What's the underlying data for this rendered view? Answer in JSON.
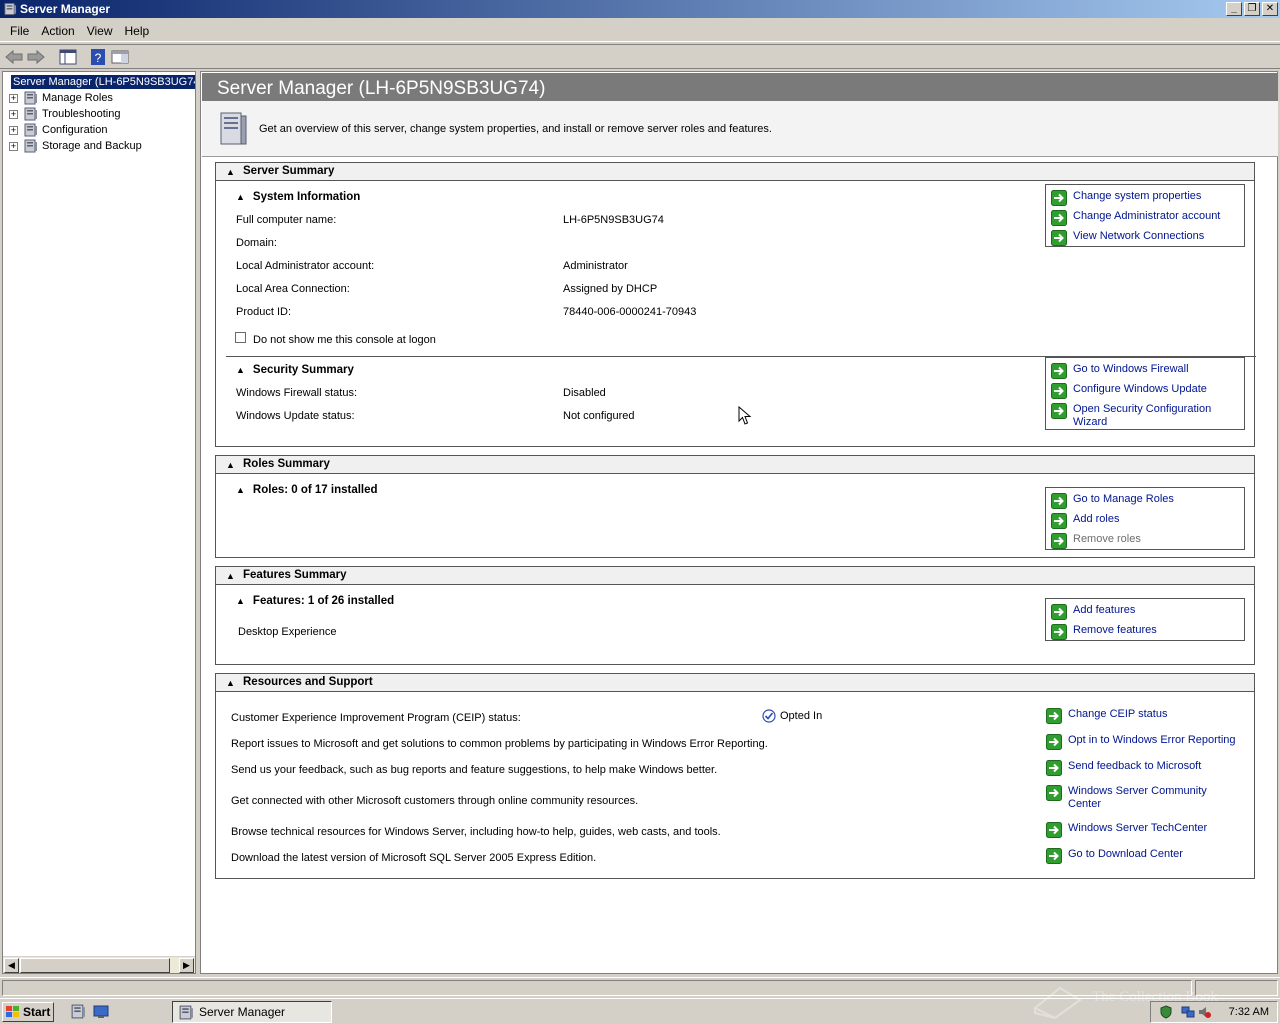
{
  "window": {
    "title": "Server Manager"
  },
  "menu": [
    "File",
    "Action",
    "View",
    "Help"
  ],
  "tree": {
    "root": "Server Manager (LH-6P5N9SB3UG74)",
    "items": [
      "Manage Roles",
      "Troubleshooting",
      "Configuration",
      "Storage and Backup"
    ]
  },
  "header": {
    "title": "Server Manager (LH-6P5N9SB3UG74)",
    "description": "Get an overview of this server, change system properties, and install or remove server roles and features."
  },
  "server_summary": {
    "title": "Server Summary",
    "system_info": {
      "title": "System Information",
      "rows": [
        {
          "label": "Full computer name:",
          "value": "LH-6P5N9SB3UG74"
        },
        {
          "label": "Domain:",
          "value": ""
        },
        {
          "label": "Local Administrator account:",
          "value": "Administrator"
        },
        {
          "label": "Local Area Connection:",
          "value": "Assigned by DHCP"
        },
        {
          "label": "Product ID:",
          "value": "78440-006-0000241-70943"
        }
      ],
      "checkbox_label": "Do not show me this console at logon",
      "tasks": [
        "Change system properties",
        "Change Administrator account",
        "View Network Connections"
      ]
    },
    "security": {
      "title": "Security Summary",
      "rows": [
        {
          "label": "Windows Firewall status:",
          "value": "Disabled"
        },
        {
          "label": "Windows Update status:",
          "value": "Not configured"
        }
      ],
      "tasks": [
        "Go to Windows Firewall",
        "Configure Windows Update",
        "Open Security Configuration Wizard"
      ]
    }
  },
  "roles_summary": {
    "title": "Roles Summary",
    "sub_title": "Roles: 0 of 17 installed",
    "tasks": [
      "Go to Manage Roles",
      "Add roles",
      "Remove roles"
    ]
  },
  "features_summary": {
    "title": "Features Summary",
    "sub_title": "Features: 1 of 26 installed",
    "installed": [
      "Desktop Experience"
    ],
    "tasks": [
      "Add features",
      "Remove features"
    ]
  },
  "resources": {
    "title": "Resources and Support",
    "ceip_status": "Opted In",
    "rows": [
      {
        "text": "Customer Experience Improvement Program (CEIP) status:",
        "task": "Change CEIP status"
      },
      {
        "text": "Report issues to Microsoft and get solutions to common problems by participating in Windows Error Reporting.",
        "task": "Opt in to Windows Error Reporting"
      },
      {
        "text": "Send us your feedback, such as bug reports and feature suggestions, to help make Windows better.",
        "task": "Send feedback to Microsoft"
      },
      {
        "text": "Get connected with other Microsoft customers through online community resources.",
        "task": "Windows Server Community Center"
      },
      {
        "text": "Browse technical resources for Windows Server, including how-to help, guides, web casts, and tools.",
        "task": "Windows Server TechCenter"
      },
      {
        "text": "Download the latest version of Microsoft SQL Server 2005 Express Edition.",
        "task": "Go to Download Center"
      }
    ]
  },
  "taskbar": {
    "start": "Start",
    "window_button": "Server Manager",
    "clock": "7:32 AM"
  },
  "watermark": "The Collection Book",
  "colors": {
    "link": "#00158f",
    "disabled_link": "#6d6d6d",
    "header_band": "#7a7a7a",
    "selection": "#0a246a"
  }
}
